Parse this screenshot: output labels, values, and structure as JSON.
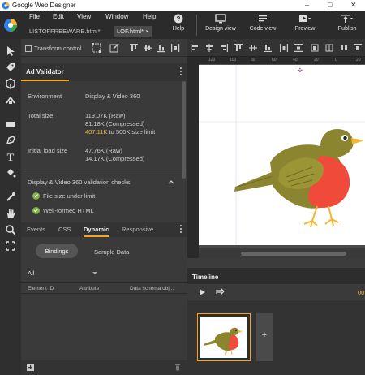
{
  "window": {
    "title": "Google Web Designer",
    "controls": [
      "–",
      "□",
      "✕"
    ]
  },
  "menu": [
    "File",
    "Edit",
    "View",
    "Window",
    "Help"
  ],
  "doc_tabs": [
    "LISTOFFREEWARE.html*",
    "LOF.html*"
  ],
  "header_buttons": {
    "help": "Help",
    "design_view": "Design view",
    "code_view": "Code view",
    "preview": "Preview",
    "publish": "Publish"
  },
  "toolbar": {
    "transform_control": "Transform control"
  },
  "ad_validator": {
    "tab": "Ad Validator",
    "environment_label": "Environment",
    "environment_value": "Display & Video 360",
    "total_size_label": "Total size",
    "total_raw": "119.07K (Raw)",
    "total_compressed": "81.18K (Compressed)",
    "total_limit_value": "407.11K",
    "total_limit_text": " to 500K size limit",
    "initial_load_label": "Initial load size",
    "initial_raw": "47.76K (Raw)",
    "initial_compressed": "14.17K (Compressed)",
    "checks_title": "Display & Video 360 validation checks",
    "checks": [
      "File size under limit",
      "Well-formed HTML"
    ]
  },
  "bottom_tabs": [
    "Events",
    "CSS",
    "Dynamic",
    "Responsive"
  ],
  "bindings_button": "Bindings",
  "sample_data": "Sample Data",
  "filter_value": "All",
  "table_headers": [
    "Element ID",
    "Attribute",
    "Data schema obj..."
  ],
  "ruler_ticks": [
    "120",
    "100",
    "80",
    "60",
    "40",
    "20",
    "0",
    "20"
  ],
  "timeline": {
    "label": "Timeline",
    "time": "00"
  },
  "add_page": "+",
  "colors": {
    "accent": "#f5a623",
    "check": "#7cb342",
    "robin_breast": "#f04a3a",
    "robin_back": "#8b8530"
  }
}
